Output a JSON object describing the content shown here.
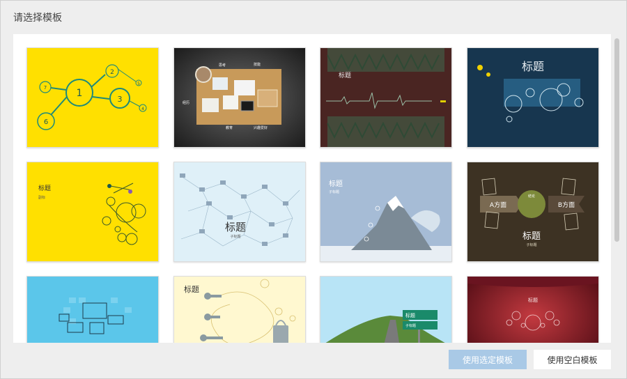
{
  "dialog": {
    "title": "请选择模板",
    "buttons": {
      "use_selected": "使用选定模板",
      "use_blank": "使用空白模板"
    }
  },
  "templates": [
    {
      "texts": [
        "1",
        "2",
        "3",
        "4",
        "5",
        "6",
        "7"
      ]
    },
    {
      "texts": [
        "思考",
        "技能",
        "经历",
        "教育",
        "兴趣爱好"
      ]
    },
    {
      "texts": [
        "标题"
      ]
    },
    {
      "texts": [
        "标题"
      ]
    },
    {
      "texts": [
        "标题",
        "副标"
      ]
    },
    {
      "texts": [
        "标题",
        "子标题"
      ]
    },
    {
      "texts": [
        "标题",
        "子标题"
      ]
    },
    {
      "texts": [
        "A方面",
        "B方面",
        "结论",
        "标题",
        "子标题"
      ]
    },
    {
      "texts": []
    },
    {
      "texts": [
        "标题"
      ]
    },
    {
      "texts": [
        "标题",
        "子标题"
      ]
    },
    {
      "texts": [
        "标题"
      ]
    }
  ],
  "colors": {
    "primary_button": "#a9c9e6",
    "yellow": "#ffe000",
    "navy": "#17364f",
    "brown": "#4a2522",
    "olive": "#3d3223"
  }
}
